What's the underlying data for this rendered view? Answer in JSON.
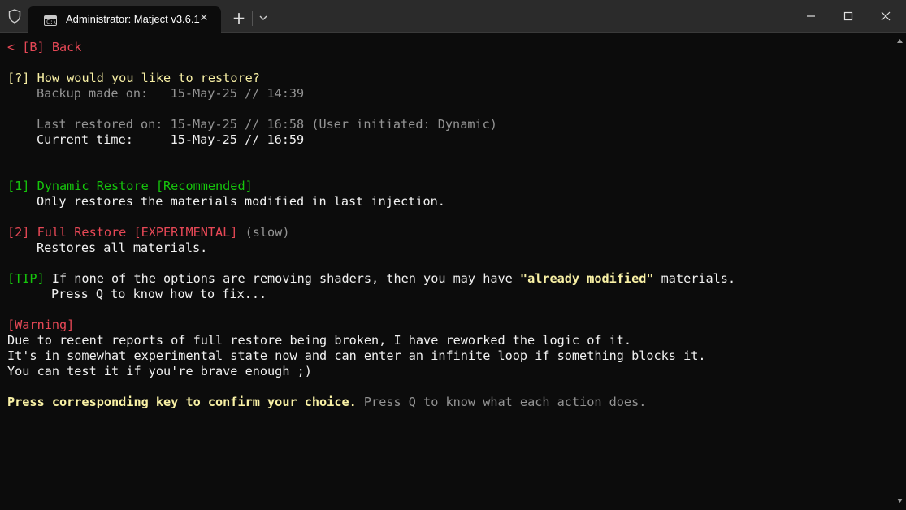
{
  "window": {
    "tab_title": "Administrator:  Matject v3.6.1",
    "tab_icon_glyph": "C:\\",
    "close_tab_glyph": "✕",
    "new_tab_glyph": "+"
  },
  "icons": [
    "shield-icon",
    "terminal-icon",
    "close-icon",
    "plus-icon",
    "chevron-down-icon",
    "minimize-icon",
    "maximize-icon",
    "close-window-icon",
    "scroll-up-icon",
    "scroll-down-icon"
  ],
  "colors": {
    "red": "#e74856",
    "yellow": "#f9f1a5",
    "gray": "#949494",
    "white": "#f2f2f2",
    "green": "#16c60c",
    "background": "#0c0c0c"
  },
  "terminal": {
    "back": "< [B] Back",
    "question_marker": "[?]",
    "question": "How would you like to restore?",
    "backup_made": "Backup made on:   15-May-25 // 14:39",
    "last_restored": "Last restored on: 15-May-25 // 16:58 (User initiated: Dynamic)",
    "current_time": "Current time:     15-May-25 // 16:59",
    "opt1_title": "[1] Dynamic Restore [Recommended]",
    "opt1_desc": "Only restores the materials modified in last injection.",
    "opt2_title": "[2] Full Restore [EXPERIMENTAL]",
    "opt2_suffix": " (slow)",
    "opt2_desc": "Restores all materials.",
    "tip_marker": "[TIP]",
    "tip_text1": " If none of the options are removing shaders, then you may have ",
    "tip_highlight": "\"already modified\"",
    "tip_text2": " materials.",
    "tip_line2": "Press Q to know how to fix...",
    "warning_marker": "[Warning]",
    "warning1": "Due to recent reports of full restore being broken, I have reworked the logic of it.",
    "warning2": "It's in somewhat experimental state now and can enter an infinite loop if something blocks it.",
    "warning3": "You can test it if you're brave enough ;)",
    "prompt_main": "Press corresponding key to confirm your choice.",
    "prompt_hint": " Press Q to know what each action does."
  }
}
